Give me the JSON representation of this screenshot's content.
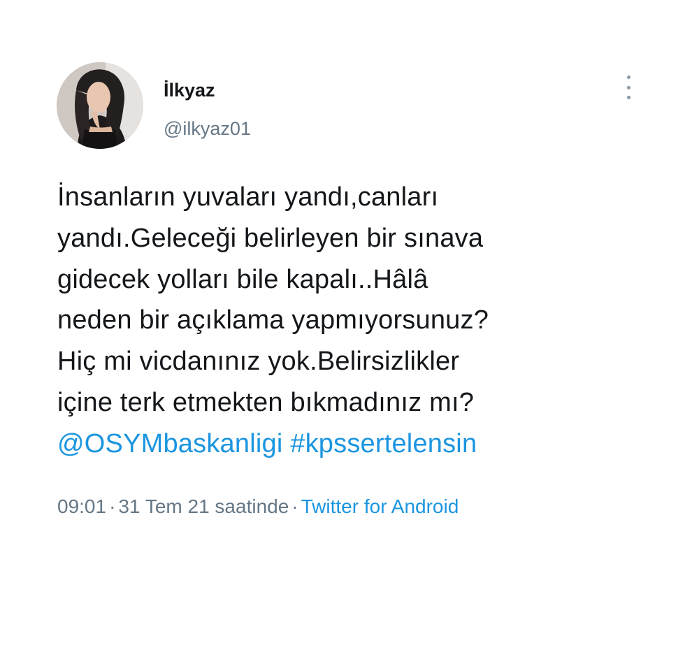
{
  "user": {
    "display_name": "İlkyaz",
    "handle": "@ilkyaz01"
  },
  "tweet": {
    "text_lines": [
      "İnsanların yuvaları yandı,canları",
      "yandı.Geleceği belirleyen bir sınava",
      "gidecek yolları bile kapalı..Hâlâ",
      "neden bir açıklama yapmıyorsunuz?",
      "Hiç mi vicdanınız yok.Belirsizlikler",
      "içine terk etmekten bıkmadınız mı?"
    ],
    "mention": "@OSYMbaskanligi",
    "hashtag": "#kpssertelensin"
  },
  "meta": {
    "time": "09:01",
    "date": "31 Tem 21 saatinde",
    "separator": "·",
    "source": "Twitter for Android"
  },
  "colors": {
    "link": "#1b95e0",
    "text": "#14171a",
    "secondary": "#657786"
  },
  "icons": {
    "more": "more-vertical-icon",
    "avatar": "profile-photo"
  }
}
